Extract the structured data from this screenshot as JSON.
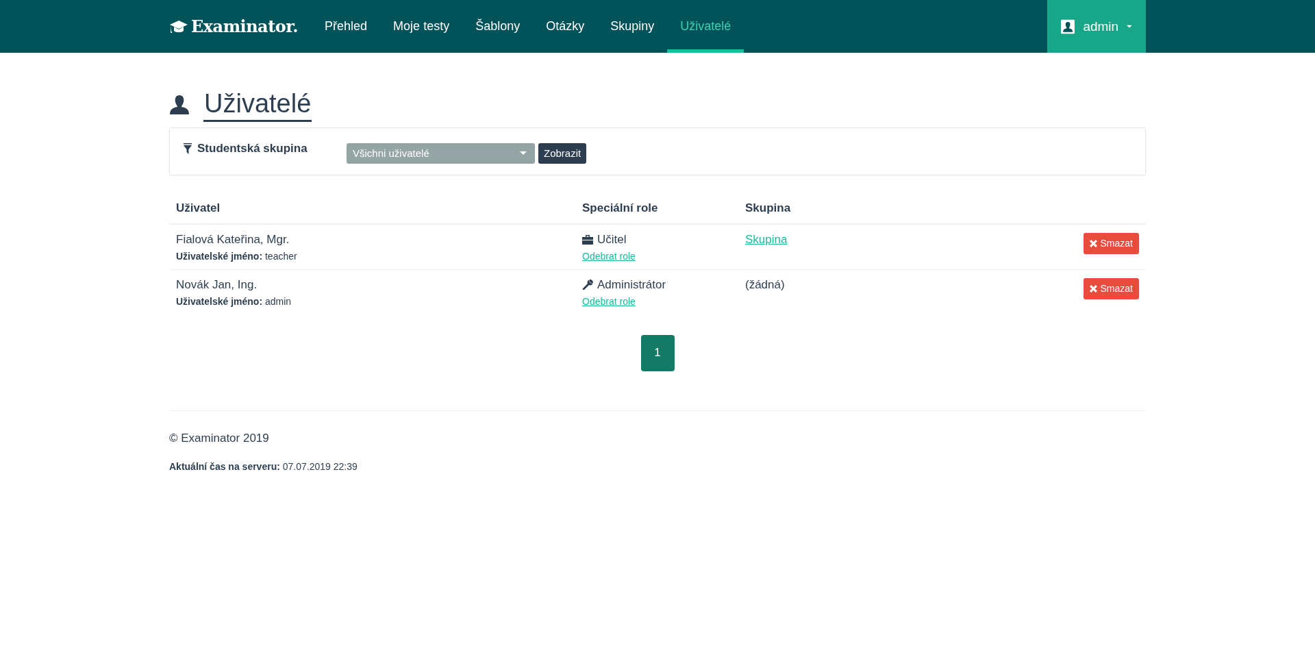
{
  "navbar": {
    "brand": "Examinator.",
    "items": [
      {
        "label": "Přehled",
        "selected": false
      },
      {
        "label": "Moje testy",
        "selected": false
      },
      {
        "label": "Šablony",
        "selected": false
      },
      {
        "label": "Otázky",
        "selected": false
      },
      {
        "label": "Skupiny",
        "selected": false
      },
      {
        "label": "Uživatelé",
        "selected": true
      }
    ],
    "user": "admin"
  },
  "page_title": "Uživatelé",
  "filter": {
    "label": "Studentská skupina",
    "select_value": "Všichni uživatelé",
    "button": "Zobrazit"
  },
  "table": {
    "columns": [
      "Uživatel",
      "Speciální role",
      "Skupina"
    ],
    "rows": [
      {
        "name": "Fialová Kateřina, Mgr.",
        "username": "**Uživatelské jméno:** teacher",
        "role": {
          "kind": "teacher",
          "label": "Učitel",
          "remove_link": "Odebrat role"
        },
        "group": {
          "kind": "link",
          "text": "Skupina"
        },
        "delete": "Smazat"
      },
      {
        "name": "Novák Jan, Ing.",
        "username": "**Uživatelské jméno:** admin",
        "role": {
          "kind": "admin",
          "label": "Administrátor",
          "remove_link": "Odebrat role"
        },
        "group": {
          "kind": "text",
          "text": "(žádná)"
        },
        "delete": "Smazat"
      }
    ]
  },
  "pagination": [
    {
      "label": "1",
      "selected": true
    }
  ],
  "footer": {
    "copyright": "© Examinator 2019",
    "server_time": "**Aktuální čas na serveru:** 07.07.2019 22:39"
  }
}
